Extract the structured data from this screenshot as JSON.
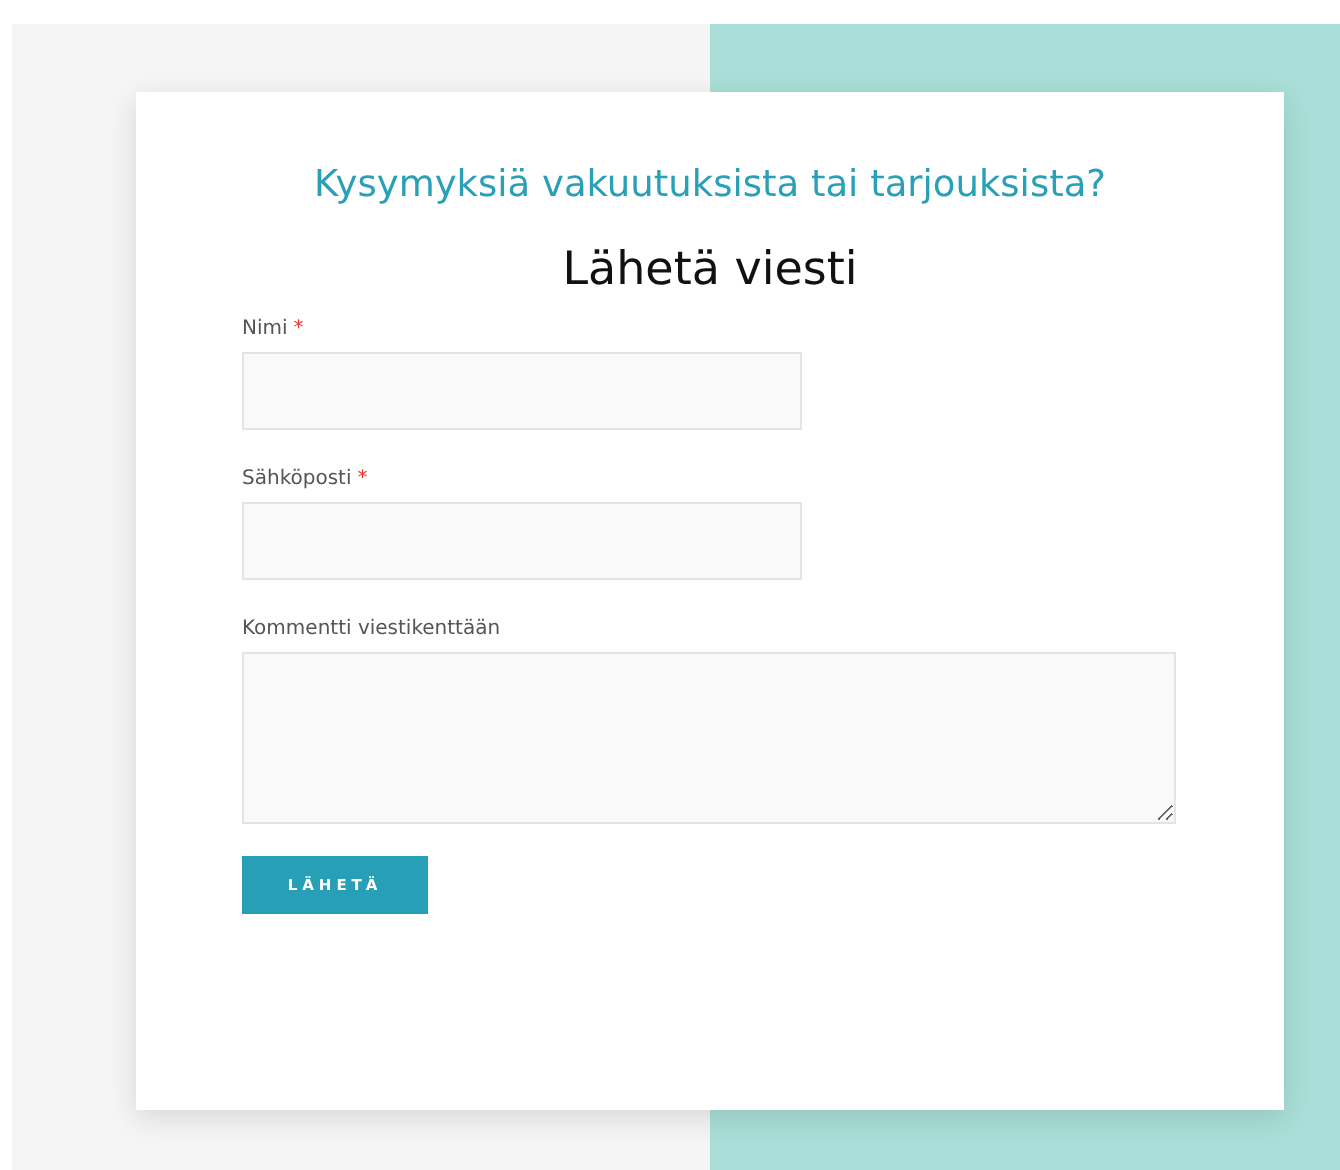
{
  "form": {
    "heading": "Kysymyksiä vakuutuksista tai tarjouksista?",
    "title": "Lähetä viesti",
    "fields": [
      {
        "kind": "text",
        "label": "Nimi",
        "required_mark": "*"
      },
      {
        "kind": "text",
        "label": "Sähköposti",
        "required_mark": "*"
      },
      {
        "kind": "textarea",
        "label": "Kommentti viestikenttään"
      }
    ],
    "submit": "LÄHETÄ"
  }
}
